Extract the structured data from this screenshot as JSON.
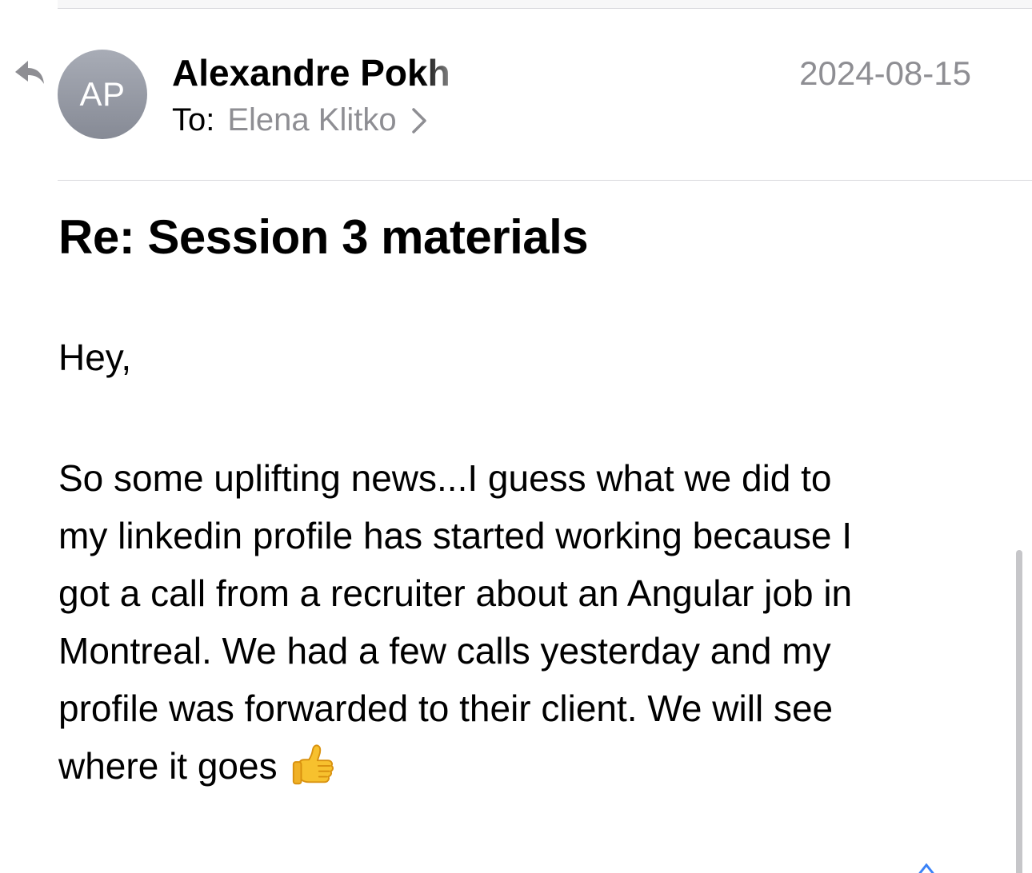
{
  "message": {
    "sender_name": "Alexandre Pokh",
    "sender_initials": "AP",
    "date": "2024-08-15",
    "to_label": "To:",
    "recipient_name": "Elena Klitko",
    "subject": "Re: Session 3 materials",
    "greeting": "Hey,",
    "body_lines": [
      "So some uplifting news...I guess what we did to",
      "my linkedin profile has started working because I",
      "got a call from a recruiter about an Angular job in",
      "Montreal. We had a few calls yesterday and my",
      "profile was forwarded to their client. We will see",
      "where it goes"
    ]
  },
  "icons": {
    "reply": "reply-arrow-icon",
    "recipient_chevron": "chevron-right-icon",
    "emoji": "thumbs-up-emoji-icon"
  },
  "colors": {
    "secondary_text": "#8e8e93",
    "avatar_gray": "#9a9ea8",
    "divider": "#d8d8dc",
    "emoji_yellow": "#f7c12e"
  }
}
